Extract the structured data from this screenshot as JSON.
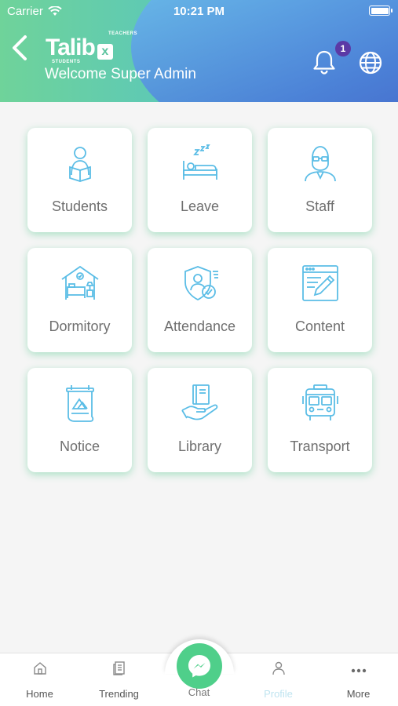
{
  "status": {
    "carrier": "Carrier",
    "time": "10:21 PM"
  },
  "header": {
    "logo_text": "Talib",
    "logo_x": "x",
    "logo_tag_top": "TEACHERS",
    "logo_tag_bottom": "STUDENTS",
    "welcome": "Welcome Super Admin",
    "notification_count": "1"
  },
  "tiles": [
    {
      "label": "Students",
      "icon": "student-reading-icon"
    },
    {
      "label": "Leave",
      "icon": "sleeping-bed-icon"
    },
    {
      "label": "Staff",
      "icon": "staff-person-icon"
    },
    {
      "label": "Dormitory",
      "icon": "dormitory-house-icon"
    },
    {
      "label": "Attendance",
      "icon": "attendance-shield-icon"
    },
    {
      "label": "Content",
      "icon": "content-edit-icon"
    },
    {
      "label": "Notice",
      "icon": "notice-board-icon"
    },
    {
      "label": "Library",
      "icon": "library-book-hand-icon"
    },
    {
      "label": "Transport",
      "icon": "bus-icon"
    }
  ],
  "tabbar": {
    "home": "Home",
    "trending": "Trending",
    "chat": "Chat",
    "profile": "Profile",
    "more": "More"
  },
  "colors": {
    "accent_green": "#4fcf8a",
    "icon_blue": "#5bbde6",
    "badge_purple": "#5b3aa6"
  }
}
